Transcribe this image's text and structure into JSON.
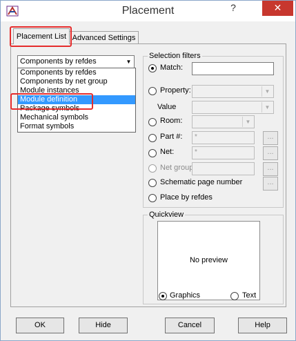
{
  "window": {
    "title": "Placement",
    "help": "?",
    "close": "✕"
  },
  "tabs": [
    {
      "label": "Placement List"
    },
    {
      "label": "Advanced Settings"
    }
  ],
  "list_type": {
    "selected": "Components by refdes",
    "options": [
      "Components by refdes",
      "Components by net group",
      "Module instances",
      "Module definition",
      "Package symbols",
      "Mechanical symbols",
      "Format symbols"
    ],
    "highlighted": "Module definition"
  },
  "filters": {
    "title": "Selection filters",
    "match": {
      "label": "Match:",
      "value": ""
    },
    "property": {
      "label": "Property:"
    },
    "value": {
      "label": "Value"
    },
    "room": {
      "label": "Room:"
    },
    "part": {
      "label": "Part #:",
      "value": "*"
    },
    "net": {
      "label": "Net:",
      "value": "*"
    },
    "net_group": {
      "label": "Net group"
    },
    "schematic": {
      "label": "Schematic page number"
    },
    "place_by_refdes": {
      "label": "Place by refdes"
    },
    "ellipsis": "..."
  },
  "quickview": {
    "title": "Quickview",
    "preview_text": "No preview",
    "graphics": "Graphics",
    "text": "Text"
  },
  "buttons": {
    "ok": "OK",
    "hide": "Hide",
    "cancel": "Cancel",
    "help": "Help"
  },
  "colors": {
    "highlight": "#3399ff",
    "annotation": "#e52b2b",
    "close": "#c7372e"
  }
}
